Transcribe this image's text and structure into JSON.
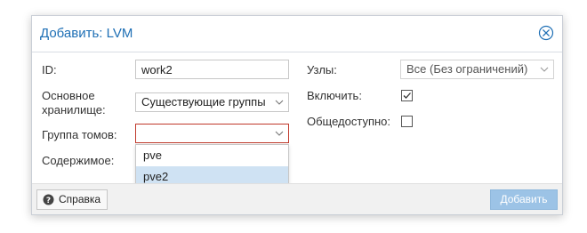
{
  "dialog": {
    "title": "Добавить: LVM"
  },
  "form": {
    "id": {
      "label": "ID:",
      "value": "work2"
    },
    "base_storage": {
      "label": "Основное хранилище:",
      "value": "Существующие группы"
    },
    "volume_group": {
      "label": "Группа томов:",
      "value": ""
    },
    "content": {
      "label": "Содержимое:"
    },
    "nodes": {
      "label": "Узлы:",
      "value": "Все (Без ограничений)"
    },
    "enable": {
      "label": "Включить:",
      "checked": true
    },
    "shared": {
      "label": "Общедоступно:",
      "checked": false
    }
  },
  "dropdown": {
    "options": [
      "pve",
      "pve2"
    ],
    "highlighted": "pve2"
  },
  "footer": {
    "help_label": "Справка",
    "add_label": "Добавить"
  },
  "colors": {
    "title": "#1e6fb5",
    "invalid_border": "#c0392b",
    "highlight": "#cfe2f3",
    "primary_disabled": "#9cc3e6"
  },
  "icons": {
    "close": "close-circle-icon",
    "help": "question-circle-icon",
    "chevron": "chevron-down-icon",
    "check": "check-icon"
  }
}
